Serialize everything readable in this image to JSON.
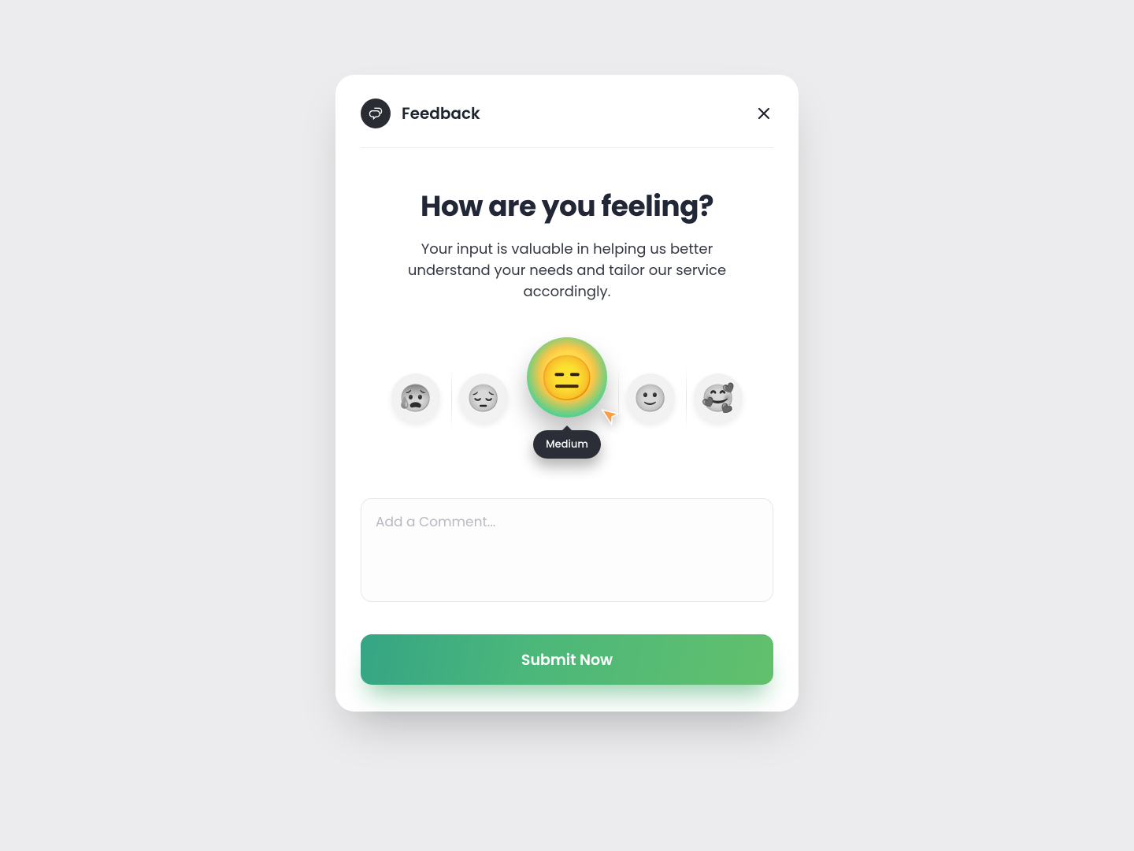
{
  "header": {
    "title": "Feedback"
  },
  "heading": "How are you feeling?",
  "subheading": "Your input is valuable in helping us better understand your needs and tailor our service accordingly.",
  "emojis": {
    "items": [
      "😰",
      "😔",
      "😑",
      "🙂",
      "🥰"
    ],
    "selected_index": 2,
    "selected_label": "Medium"
  },
  "comment": {
    "placeholder": "Add a Comment...",
    "value": ""
  },
  "submit_label": "Submit Now"
}
